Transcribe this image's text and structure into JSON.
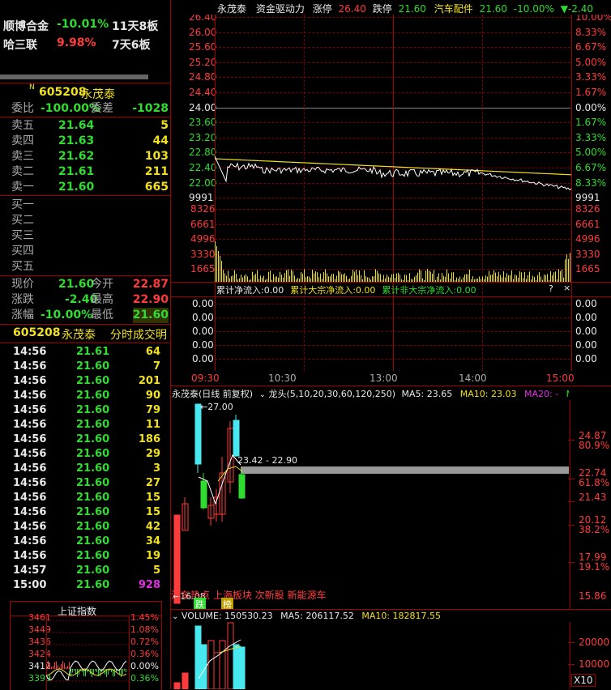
{
  "related": [
    {
      "name": "顺博合金",
      "change": "-10.01%",
      "streak": "11天8板"
    },
    {
      "name": "哈三联",
      "change": "9.98%",
      "streak": "7天6板"
    }
  ],
  "stock": {
    "badge": "N",
    "code": "605208",
    "name": "永茂泰"
  },
  "orderbook": {
    "weibi_label": "委比",
    "weibi": "-100.00%",
    "weicha_label": "委差",
    "weicha": "-1028",
    "asks": [
      {
        "label": "卖五",
        "price": "21.64",
        "vol": "5"
      },
      {
        "label": "卖四",
        "price": "21.63",
        "vol": "44"
      },
      {
        "label": "卖三",
        "price": "21.62",
        "vol": "103"
      },
      {
        "label": "卖二",
        "price": "21.61",
        "vol": "211"
      },
      {
        "label": "卖一",
        "price": "21.60",
        "vol": "665"
      }
    ],
    "bids": [
      {
        "label": "买一"
      },
      {
        "label": "买二"
      },
      {
        "label": "买三"
      },
      {
        "label": "买四"
      },
      {
        "label": "买五"
      }
    ]
  },
  "quote": {
    "now_label": "现价",
    "now": "21.60",
    "open_label": "今开",
    "open": "22.87",
    "chg_label": "涨跌",
    "chg": "-2.40",
    "high_label": "最高",
    "high": "22.90",
    "pct_label": "涨幅",
    "pct": "-10.00%",
    "low_label": "最低",
    "low": "21.60"
  },
  "ticks_header": {
    "code": "605208",
    "name": "永茂泰",
    "title": "分时成交明"
  },
  "ticks": [
    {
      "t": "14:56",
      "p": "21.61",
      "v": "64"
    },
    {
      "t": "14:56",
      "p": "21.60",
      "v": "7"
    },
    {
      "t": "14:56",
      "p": "21.60",
      "v": "201"
    },
    {
      "t": "14:56",
      "p": "21.60",
      "v": "90"
    },
    {
      "t": "14:56",
      "p": "21.60",
      "v": "79"
    },
    {
      "t": "14:56",
      "p": "21.60",
      "v": "11"
    },
    {
      "t": "14:56",
      "p": "21.60",
      "v": "186"
    },
    {
      "t": "14:56",
      "p": "21.60",
      "v": "29"
    },
    {
      "t": "14:56",
      "p": "21.60",
      "v": "3"
    },
    {
      "t": "14:56",
      "p": "21.60",
      "v": "27"
    },
    {
      "t": "14:56",
      "p": "21.60",
      "v": "15"
    },
    {
      "t": "14:56",
      "p": "21.60",
      "v": "15"
    },
    {
      "t": "14:56",
      "p": "21.60",
      "v": "42"
    },
    {
      "t": "14:56",
      "p": "21.60",
      "v": "34"
    },
    {
      "t": "14:56",
      "p": "21.60",
      "v": "19"
    },
    {
      "t": "14:57",
      "p": "21.60",
      "v": "5"
    },
    {
      "t": "15:00",
      "p": "21.60",
      "v": "928"
    }
  ],
  "index_mini": {
    "title": "上证指数",
    "left_labels": [
      "3461",
      "3449",
      "3436",
      "3424",
      "3412",
      "3399"
    ],
    "right_labels": [
      "1.45%",
      "1.08%",
      "0.72%",
      "0.36%",
      "0.00%",
      "0.36%"
    ]
  },
  "intraday": {
    "header": {
      "name": "永茂泰",
      "concept": "资金驱动力",
      "limit_up_label": "涨停",
      "limit_up": "26.40",
      "limit_down_label": "跌停",
      "limit_down": "21.60",
      "sector": "汽车配件",
      "sector_price": "21.60",
      "sector_pct": "-10.00%",
      "sector_chg": "-2.40",
      "arrow": "▼"
    },
    "price_labels": [
      "26.40",
      "26.00",
      "25.60",
      "25.20",
      "24.80",
      "24.40",
      "24.00",
      "23.60",
      "23.20",
      "22.80",
      "22.40",
      "22.00",
      "9991"
    ],
    "pct_labels": [
      "10.00%",
      "8.33%",
      "6.67%",
      "5.00%",
      "3.33%",
      "1.67%",
      "0.00%",
      "1.67%",
      "3.33%",
      "5.00%",
      "6.67%",
      "8.33%",
      "9991"
    ],
    "vol_labels": [
      "8326",
      "6661",
      "4996",
      "3330",
      "1665"
    ],
    "flow_header": {
      "a": "累计净流入:0.00",
      "b": "累计大宗净流入:0.00",
      "c": "累计非大宗净流入:0.00"
    },
    "flow_labels": [
      "0.00",
      "0.00",
      "0.00",
      "0.00",
      "0.00"
    ],
    "time_labels": [
      "09:30",
      "10:30",
      "13:00",
      "14:00",
      "15:00"
    ]
  },
  "kline": {
    "header": {
      "name": "永茂泰(日线 前复权)",
      "indicator": "龙头(5,10,20,30,60,120,250)",
      "ma5": "MA5: 23.65",
      "ma10": "MA10: 23.03",
      "ma20": "MA20: -",
      "ma": "MA"
    },
    "high_note": "27.00",
    "range_note": "23.42 - 22.90",
    "low_note": "16.08",
    "tags": "汽车热点 上海板块 次新股 新能源车",
    "tag_die": "跌",
    "tag_bang": "榜",
    "right_labels": [
      {
        "v": "24.87",
        "c": "price"
      },
      {
        "v": "80.9%",
        "c": "pct"
      },
      {
        "v": "22.74",
        "c": "price"
      },
      {
        "v": "61.8%",
        "c": "pct"
      },
      {
        "v": "21.43",
        "c": "price"
      },
      {
        "v": "20.12",
        "c": "price"
      },
      {
        "v": "38.2%",
        "c": "pct"
      },
      {
        "v": "17.99",
        "c": "price"
      },
      {
        "v": "19.1%",
        "c": "pct"
      },
      {
        "v": "15.86",
        "c": "price"
      }
    ]
  },
  "volume": {
    "header": {
      "label": "VOLUME: 150530.23",
      "ma5": "MA5: 206117.52",
      "ma10": "MA10: 182817.55"
    },
    "labels": [
      "20000",
      "10000"
    ],
    "unit": "X10"
  },
  "colors": {
    "up": "#ff3b3b",
    "down": "#2fdc2f",
    "grid": "#7a0000",
    "axis": "#a00000"
  }
}
